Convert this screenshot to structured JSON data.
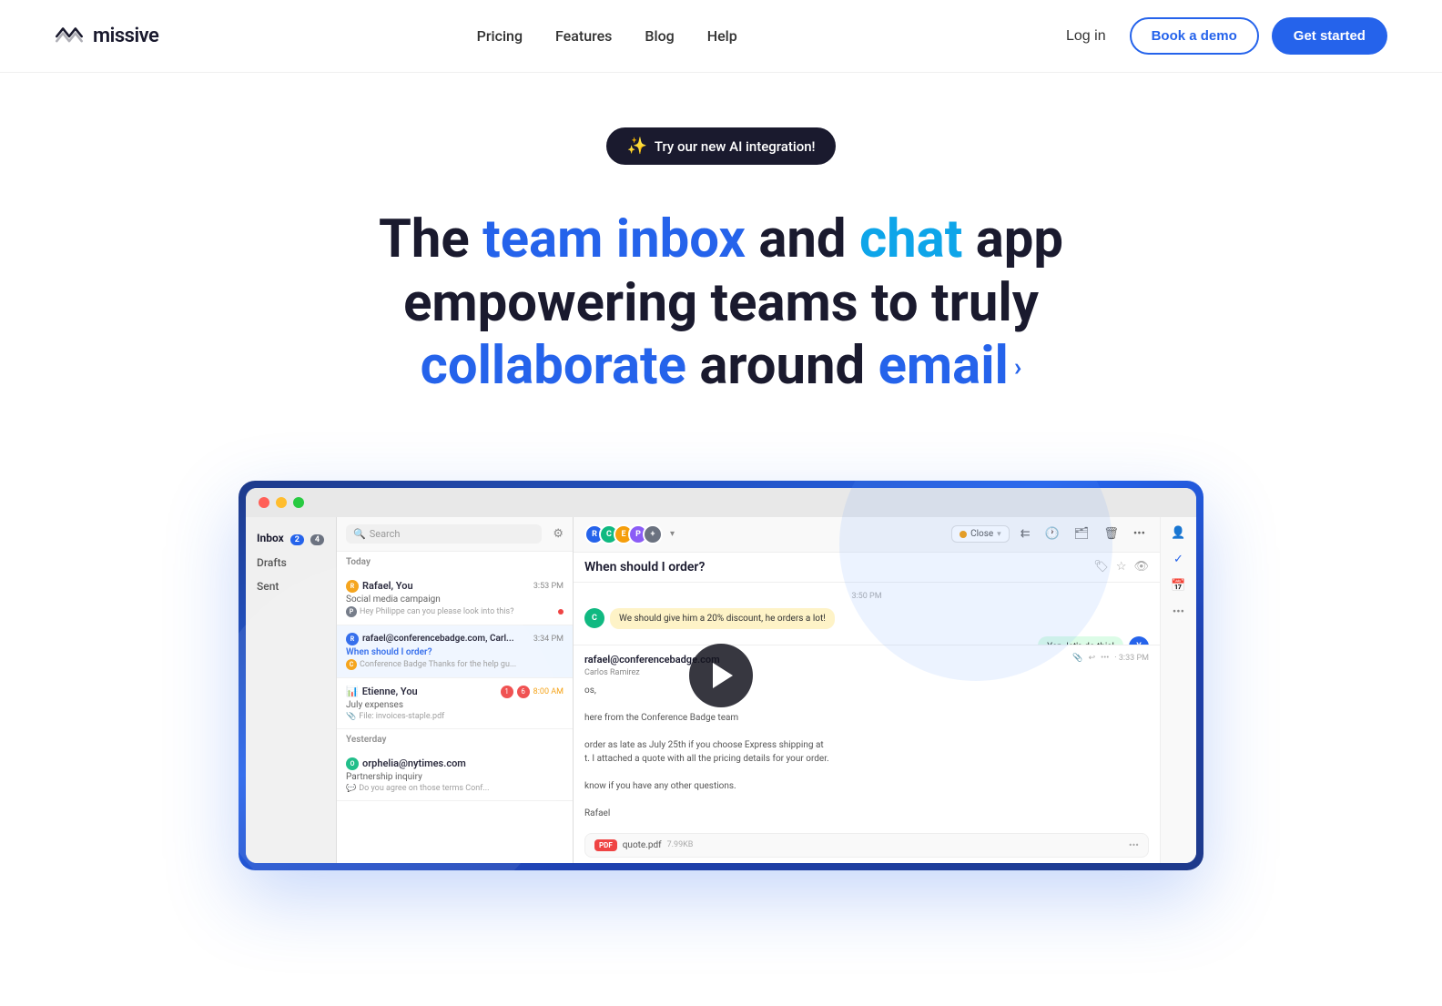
{
  "nav": {
    "logo_text": "missive",
    "links": [
      {
        "label": "Pricing",
        "href": "#"
      },
      {
        "label": "Features",
        "href": "#"
      },
      {
        "label": "Blog",
        "href": "#"
      },
      {
        "label": "Help",
        "href": "#"
      }
    ],
    "login_label": "Log in",
    "book_demo_label": "Book a demo",
    "get_started_label": "Get started"
  },
  "hero": {
    "badge_label": "Try our new AI integration!",
    "headline_part1": "The ",
    "headline_accent1": "team inbox",
    "headline_part2": " and ",
    "headline_accent2": "chat",
    "headline_part3": " app empowering teams to truly ",
    "headline_accent3": "collaborate",
    "headline_part4": " around ",
    "headline_accent4": "email"
  },
  "app": {
    "sidebar": {
      "items": [
        {
          "label": "Inbox",
          "badge1": "2",
          "badge2": "4"
        },
        {
          "label": "Drafts",
          "badge1": "",
          "badge2": ""
        },
        {
          "label": "Sent",
          "badge1": "",
          "badge2": ""
        }
      ]
    },
    "email_list": {
      "search_placeholder": "Search",
      "date_today": "Today",
      "date_yesterday": "Yesterday",
      "emails": [
        {
          "sender": "Rafael, You",
          "time": "3:53 PM",
          "subject": "Social media campaign",
          "preview": "Hey Philippe can you please look into this?",
          "has_dot_red": true,
          "active": false,
          "avatar_color": "#f59e0b"
        },
        {
          "sender": "rafael@conferencebadge.com, Carl...",
          "time": "3:34 PM",
          "subject": "When should I order?",
          "preview": "Conference Badge Thanks for the help gu...",
          "has_dot_red": false,
          "active": true,
          "avatar_color": "#2563eb"
        },
        {
          "sender": "Etienne, You",
          "time": "8:00 AM",
          "subject": "July expenses",
          "preview": "File: invoices-staple.pdf",
          "has_dot_red": false,
          "active": false,
          "avatar_color": "#8b5cf6",
          "unread": "1",
          "unread2": "6"
        },
        {
          "sender": "orphelia@nytimes.com",
          "time": "",
          "subject": "Partnership inquiry",
          "preview": "Do you agree on those terms Conf...",
          "has_dot_blue": true,
          "active": false,
          "avatar_color": "#10b981"
        }
      ]
    },
    "email_detail": {
      "subject": "When should I order?",
      "close_label": "Close",
      "messages": [
        {
          "time": "3:50 PM",
          "text": "We should give him a 20% discount, he orders a lot!",
          "type": "highlight",
          "avatar_color": "#10b981"
        },
        {
          "time": "",
          "text": "Yep, let's do this!",
          "type": "green",
          "avatar_color": "#2563eb"
        }
      ],
      "email_from": "rafael@conferencebadge.com",
      "email_from_sub": "Carlos Ramirez",
      "email_time": "3:33 PM",
      "email_body": "os,\n\nere from the Conference Badge team\n\n order as late as July 25th if you choose Express shipping at t. I attached a quote with all the pricing details for your order.\n\nknow if you have any other questions.\n\nRafael",
      "attachment_name": "quote.pdf",
      "attachment_size": "7.99KB",
      "attachment_type": "PDF"
    }
  }
}
